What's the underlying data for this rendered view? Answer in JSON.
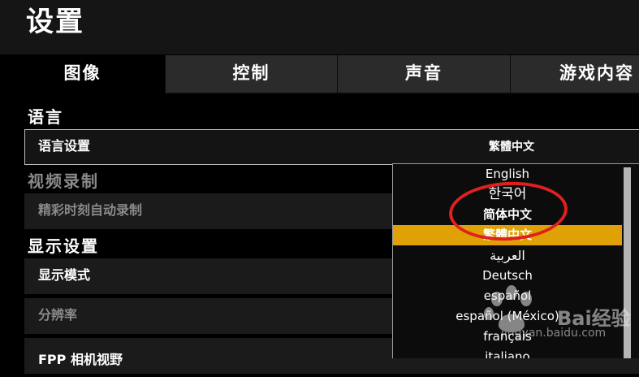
{
  "header": {
    "title": "设置"
  },
  "tabs": [
    {
      "label": "图像",
      "active": true
    },
    {
      "label": "控制",
      "active": false
    },
    {
      "label": "声音",
      "active": false
    },
    {
      "label": "游戏内容",
      "active": false
    }
  ],
  "sections": {
    "language": {
      "title": "语言",
      "rows": [
        {
          "label": "语言设置",
          "value": "繁體中文"
        }
      ]
    },
    "video_recording": {
      "title": "视频录制",
      "rows": [
        {
          "label": "精彩时刻自动录制"
        }
      ]
    },
    "display": {
      "title": "显示设置",
      "rows": [
        {
          "label": "显示模式"
        },
        {
          "label": "分辨率"
        },
        {
          "label": "FPP 相机视野"
        }
      ]
    }
  },
  "language_dropdown": {
    "selected": "繁體中文",
    "options": [
      "English",
      "한국어",
      "简体中文",
      "繁體中文",
      "العربية",
      "Deutsch",
      "español",
      "español (México)",
      "français",
      "italiano"
    ]
  },
  "watermark": {
    "text": "Bai经验",
    "url": "jingyan.baidu.com"
  },
  "colors": {
    "highlight": "#e0a106",
    "annotation": "#e0201f"
  }
}
